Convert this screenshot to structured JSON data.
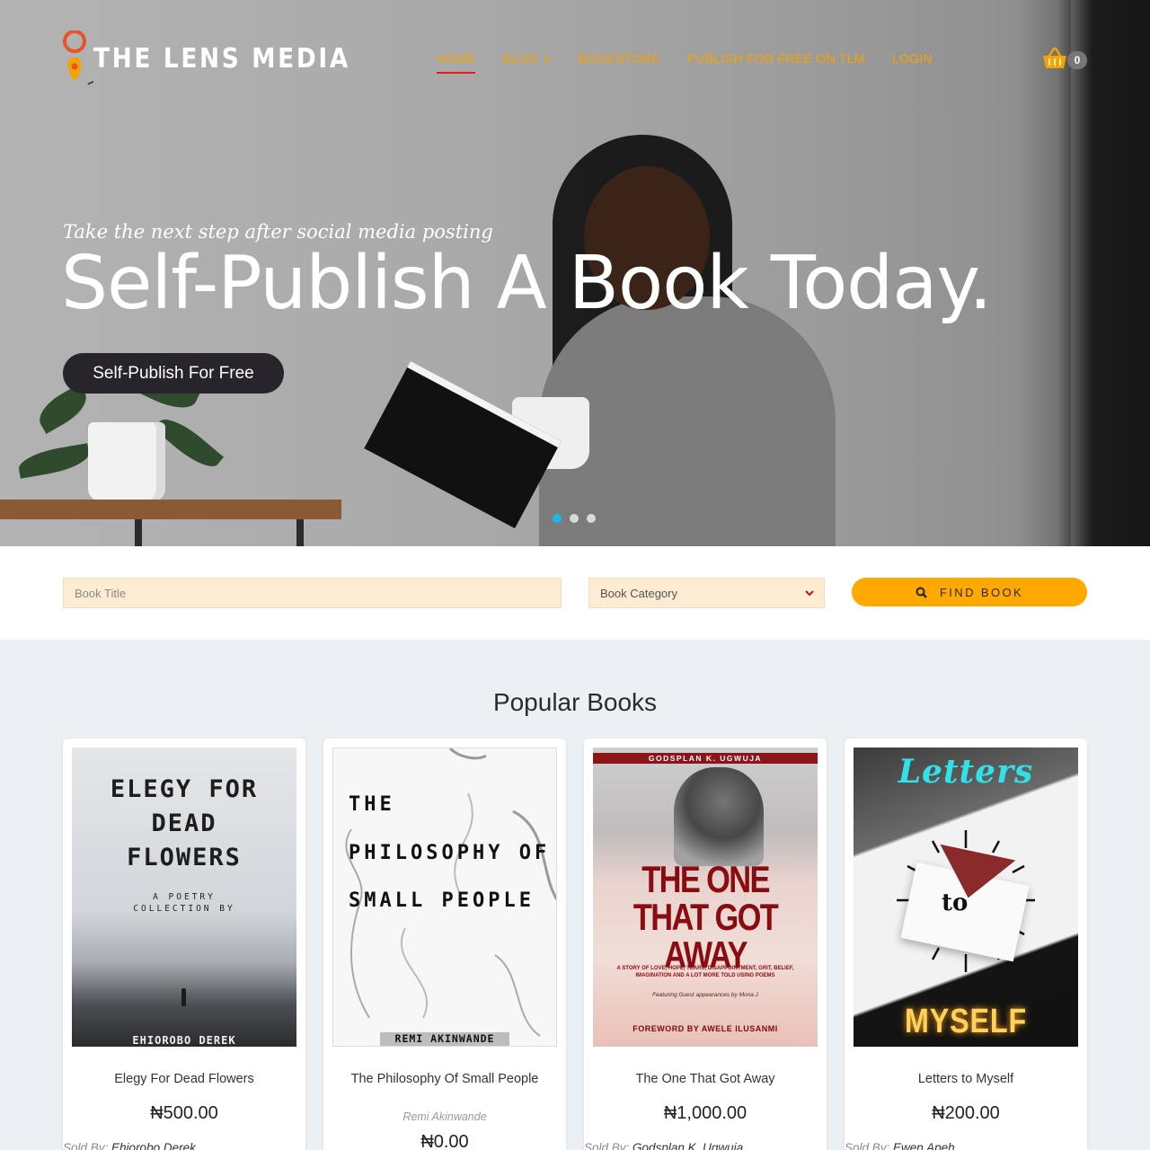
{
  "brand": {
    "name": "THE LENS MEDIA"
  },
  "nav": {
    "home": "HOME",
    "blog": "BLOG",
    "bookstore": "BOOKSTORE",
    "publish": "PUBLISH FOR FREE ON TLM",
    "login": "LOGIN"
  },
  "cart": {
    "count": "0",
    "icon": "basket-icon"
  },
  "hero": {
    "tagline": "Take the next step after social media posting",
    "headline": "Self-Publish A Book Today.",
    "button": "Self-Publish For Free",
    "slides": 3,
    "active_slide": 1
  },
  "search": {
    "title_placeholder": "Book Title",
    "category_value": "Book Category",
    "button": "FIND BOOK"
  },
  "colors": {
    "accent": "#ffa800",
    "nav": "#f5a300",
    "active_underline": "#d71f1f",
    "dot_active": "#1fb5e8"
  },
  "popular": {
    "title": "Popular Books",
    "sold_by_label": "Sold By:",
    "books": [
      {
        "name": "Elegy For Dead Flowers",
        "price": "₦500.00",
        "seller": "Ehiorobo Derek",
        "cover": {
          "title": "ELEGY FOR DEAD FLOWERS",
          "subtitle": "A POETRY COLLECTION BY",
          "author": "EHIOROBO DEREK"
        }
      },
      {
        "name": "The Philosophy Of Small People",
        "author": "Remi Akinwande",
        "price": "₦0.00",
        "cover": {
          "title": "THE PHILOSOPHY OF SMALL PEOPLE",
          "author": "REMI AKINWANDE"
        }
      },
      {
        "name": "The One That Got Away",
        "price": "₦1,000.00",
        "seller": "Godsplan K. Ugwuja",
        "cover": {
          "author": "GODSPLAN K. UGWUJA",
          "title": "THE ONE THAT GOT AWAY",
          "subtitle": "A STORY OF LOVE, HOPE, TEARS, DISAPPOINTMENT, GRIT, BELIEF, IMAGINATION AND A LOT MORE TOLD USING POEMS",
          "featuring": "Featuring Guest appearances by Mona J",
          "foreword": "FOREWORD BY AWELE ILUSANMI"
        }
      },
      {
        "name": "Letters to Myself",
        "price": "₦200.00",
        "seller": "Ewen Apeh",
        "cover": {
          "title_top": "Letters",
          "title_mid": "to",
          "title_bottom": "MYSELF"
        }
      }
    ]
  }
}
